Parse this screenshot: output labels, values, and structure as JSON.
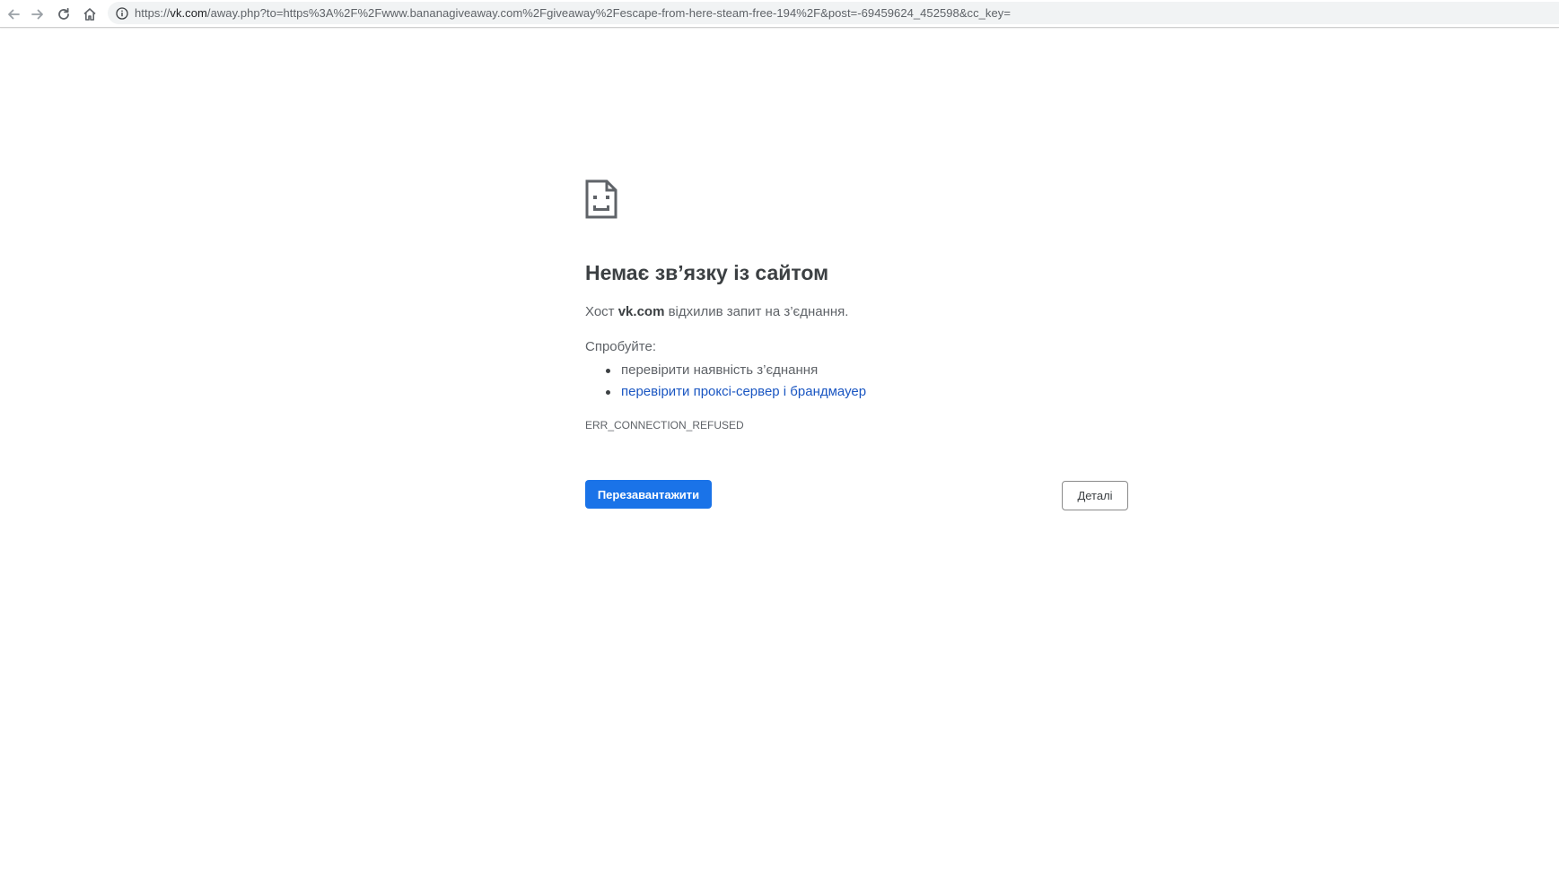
{
  "browser": {
    "url": {
      "host": "vk.com",
      "prefix": "https://",
      "rest": "/away.php?to=https%3A%2F%2Fwww.bananagiveaway.com%2Fgiveaway%2Fescape-from-here-steam-free-194%2F&post=-69459624_452598&cc_key="
    },
    "icons": {
      "back": "arrow-left-icon",
      "forward": "arrow-right-icon",
      "reload": "reload-icon",
      "home": "home-icon",
      "site_info": "info-icon"
    }
  },
  "error_page": {
    "icon": "sad-document-icon",
    "title": "Немає зв’язку із сайтом",
    "message_prefix": "Хост ",
    "message_host": "vk.com",
    "message_suffix": " відхилив запит на з’єднання.",
    "try_label": "Спробуйте:",
    "suggestions": [
      {
        "text": "перевірити наявність з’єднання",
        "is_link": false
      },
      {
        "text": "перевірити проксі-сервер і брандмауер",
        "is_link": true
      }
    ],
    "error_code": "ERR_CONNECTION_REFUSED",
    "reload_label": "Перезавантажити",
    "details_label": "Деталі"
  },
  "colors": {
    "primary_button": "#1a73e8",
    "link": "#1a56c2",
    "text": "#5f6368",
    "heading": "#3c4043"
  }
}
